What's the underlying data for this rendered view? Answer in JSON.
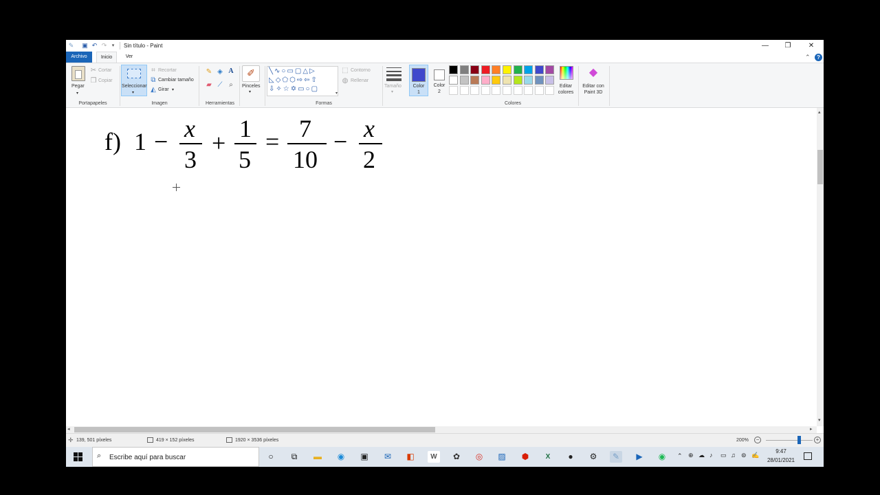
{
  "window": {
    "title": "Sin título - Paint",
    "buttons": {
      "minimize": "—",
      "restore": "❐",
      "close": "✕"
    }
  },
  "tabs": {
    "file": "Archivo",
    "home": "Inicio",
    "view": "Ver"
  },
  "ribbon": {
    "clipboard": {
      "label": "Portapapeles",
      "paste": "Pegar",
      "cut": "Cortar",
      "copy": "Copiar"
    },
    "image": {
      "label": "Imagen",
      "select": "Seleccionar",
      "crop": "Recortar",
      "resize": "Cambiar tamaño",
      "rotate": "Girar"
    },
    "tools": {
      "label": "Herramientas"
    },
    "brushes": {
      "label": "Pinceles"
    },
    "shapes": {
      "label": "Formas",
      "outline": "Contorno",
      "fill": "Rellenar"
    },
    "size": {
      "label": "Tamaño"
    },
    "color1": {
      "line1": "Color",
      "line2": "1",
      "value": "#3f48cc"
    },
    "color2": {
      "line1": "Color",
      "line2": "2",
      "value": "#ffffff"
    },
    "colors": {
      "label": "Colores",
      "row1": [
        "#000000",
        "#7f7f7f",
        "#880015",
        "#ed1c24",
        "#ff7f27",
        "#fff200",
        "#22b14c",
        "#00a2e8",
        "#3f48cc",
        "#a349a4"
      ],
      "row2": [
        "#ffffff",
        "#c3c3c3",
        "#b97a57",
        "#ffaec9",
        "#ffc90e",
        "#efe4b0",
        "#b5e61d",
        "#99d9ea",
        "#7092be",
        "#c8bfe7"
      ],
      "edit_line1": "Editar",
      "edit_line2": "colores"
    },
    "paint3d": {
      "line1": "Editar con",
      "line2": "Paint 3D"
    }
  },
  "equation": {
    "label": "f)",
    "one": "1",
    "minus": "−",
    "plus": "+",
    "equals": "=",
    "f1": {
      "num": "x",
      "den": "3"
    },
    "f2": {
      "num": "1",
      "den": "5"
    },
    "f3": {
      "num": "7",
      "den": "10"
    },
    "f4": {
      "num": "x",
      "den": "2"
    }
  },
  "status": {
    "cursor": "139, 501 píxeles",
    "selection": "419 × 152 píxeles",
    "canvas": "1920 × 3536 píxeles",
    "zoom": "200%",
    "zoom_level_fraction": 0.7
  },
  "taskbar": {
    "search_placeholder": "Escribe aquí para buscar",
    "time": "9:47",
    "date": "28/01/2021"
  }
}
